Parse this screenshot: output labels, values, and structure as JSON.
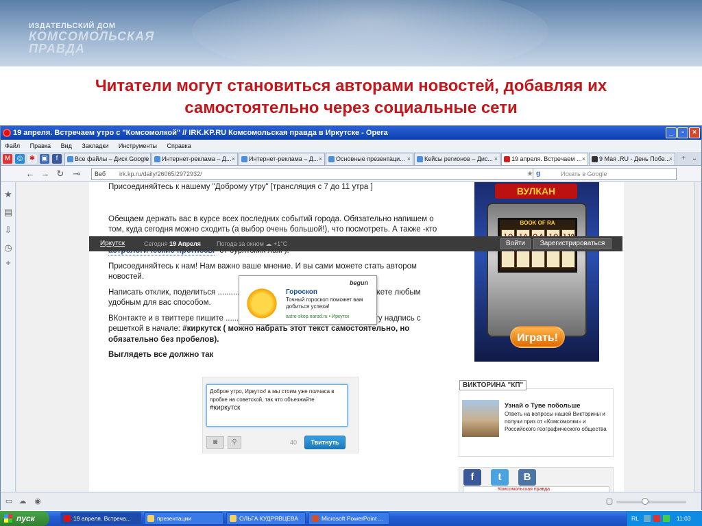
{
  "header": {
    "logo_line1": "ИЗДАТЕЛЬСКИЙ ДОМ",
    "logo_line2": "КОМСОМОЛЬСКАЯ",
    "logo_line3": "ПРАВДА"
  },
  "headline_line1": "Читатели  могут становиться авторами новостей, добавляя их",
  "headline_line2": "самостоятельно через социальные сети",
  "window": {
    "title": "19 апреля. Встречаем утро с \"Комсомолкой\" // IRK.KP.RU Комсомольская правда в Иркутске - Opera",
    "minimize": "_",
    "maximize": "▫",
    "close": "×"
  },
  "menu": [
    "Файл",
    "Правка",
    "Вид",
    "Закладки",
    "Инструменты",
    "Справка"
  ],
  "tabs": [
    {
      "label": "Все файлы – Диск Google"
    },
    {
      "label": "Интернет-реклама – Д..."
    },
    {
      "label": "Интернет-реклама – Д..."
    },
    {
      "label": "Основные презентаци..."
    },
    {
      "label": "Кейсы регионов – Дис..."
    },
    {
      "label": "19 апреля. Встречаем ..."
    },
    {
      "label": "9 Мая .RU - День Побе..."
    }
  ],
  "address": {
    "prefix": "Веб",
    "url": "irk.kp.ru/daily/26065/2972932/",
    "search_placeholder": "Искать в Google"
  },
  "site": {
    "city": "Иркутск",
    "today_label": "Сегодня",
    "today_date": "19 Апреля",
    "weather": "Погода за окном",
    "temperature": "+1°C",
    "login": "Войти",
    "register": "Зарегистрироваться"
  },
  "article": {
    "p0": "Присоединяйтесь к нашему \"Доброму утру\" [трансляция с 7 до 11 утра ]",
    "p1": "Обещаем держать вас в курсе всех последних событий города. Обязательно напишем о том, куда сегодня можно сходить (а выбор очень большой!), что посмотреть. А также -кто и какие прогнозы дает на сегодняшний день ( кстати, у нас на сайте самые уважаемые",
    "p1_link": "астрологические прогнозы",
    "p1_tail": "-от бурятских лам ).",
    "p2": "Присоединяйтесь к нам! Нам важно ваше мнение. И вы сами можете стать автором новостей.",
    "p3": "Написать отклик, поделиться ...................................... настроением вы можете любым удобным для вас способом.",
    "p4_a": "ВКонтакте и в твиттере  пишите ...................................... ичке, копируете эту надпись с решеткой в начале:",
    "p4_tag": "#киркутск ( можно набрать этот текст самостоятельно, но обязательно без пробелов).",
    "p5": "Выглядеть все должно так"
  },
  "popup": {
    "brand": "begun",
    "title": "Гороскоп",
    "desc": "Точный гороскоп поможет вам добиться успеха!",
    "url": "astro-skop.narod.ru • Иркутск"
  },
  "ad": {
    "logo": "ВУЛКАН",
    "screen_title": "BOOK OF RA",
    "reels": [
      "J Q K",
      "J A 10",
      "Q A K",
      "J Q A",
      "J 10 K"
    ],
    "play": "Играть!"
  },
  "tweet": {
    "text": "Доброе утро, Иркутск! а мы стоим уже полчаса в пробке на советской,  так что объезжайте",
    "tag": "#киркутск",
    "count": "40",
    "button": "Твитнуть"
  },
  "quiz": {
    "title": "ВИКТОРИНА \"КП\"",
    "head": "Узнай о Туве побольше",
    "desc": "Ответь на вопросы нашей Викторины и получи приз от «Комсомолки» и Российского географического общества"
  },
  "social": [
    "f",
    "t",
    "B"
  ],
  "kp_strip": "Комсомольская правда",
  "taskbar": {
    "start": "пуск",
    "tasks": [
      "19 апреля. Встреча...",
      "презентации",
      "ОЛЬГА КУДРЯВЦЕВА",
      "Microsoft PowerPoint ..."
    ],
    "lang": "RL",
    "clock": "11:03"
  },
  "colors": {
    "headline": "#c2161b",
    "titlebar": "#0b3fb0",
    "link": "#1a4e9c",
    "tweet_button": "#1c7bc0"
  }
}
